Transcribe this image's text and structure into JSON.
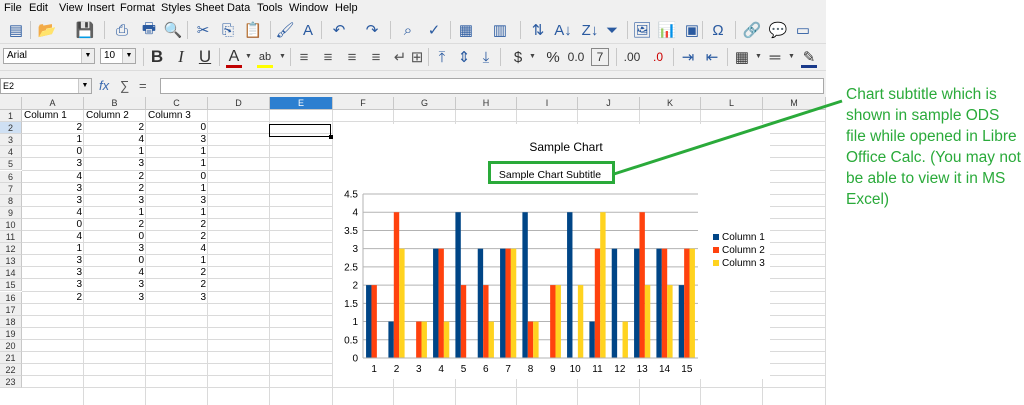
{
  "menu": [
    "File",
    "Edit",
    "View",
    "Insert",
    "Format",
    "Styles",
    "Sheet",
    "Data",
    "Tools",
    "Window",
    "Help"
  ],
  "toolbar1": {
    "icons": [
      "new-icon",
      "open-icon",
      "save-icon",
      "export-pdf-icon",
      "print-icon",
      "print-preview-icon",
      "cut-icon",
      "copy-icon",
      "paste-icon",
      "clone-formatting-icon",
      "clear-formatting-icon",
      "undo-icon",
      "redo-icon",
      "find-replace-icon",
      "spelling-icon",
      "row-icon",
      "column-icon",
      "sort-icon",
      "sort-ascending-icon",
      "sort-descending-icon",
      "autofilter-icon",
      "image-icon",
      "chart-icon",
      "pivot-table-icon",
      "special-character-icon",
      "hyperlink-icon",
      "comment-icon",
      "headers-footers-icon"
    ],
    "glyphs": [
      "▤",
      "📂",
      "💾",
      "⎙",
      "🖶",
      "🔍",
      "✂",
      "⎘",
      "📋",
      "🖌",
      "A",
      "↶",
      "↷",
      "⌕",
      "✓",
      "▦",
      "▥",
      "⇅",
      "A↓",
      "Z↓",
      "⏷",
      "🖼",
      "📊",
      "▣",
      "Ω",
      "🔗",
      "💬",
      "▭"
    ]
  },
  "toolbar2": {
    "font_name": "Arial",
    "font_size": "10",
    "glyphs": {
      "bold": "B",
      "italic": "I",
      "underline": "U",
      "font_color": "A",
      "highlight": "ab",
      "align_left": "≡",
      "align_center": "≡",
      "align_right": "≡",
      "justify": "≡",
      "wrap": "↵",
      "merge": "⊞",
      "align_top": "⤒",
      "align_middle": "⇕",
      "align_bottom": "⤓",
      "currency": "$",
      "percent": "%",
      "number": "0.0",
      "date": "7",
      "add_decimal": ".00",
      "delete_decimal": ".0",
      "indent_increase": "⇥",
      "indent_decrease": "⇤",
      "borders": "▦",
      "border_style": "═",
      "border_color": "✎"
    },
    "colors": {
      "font_color_bar": "#c00000",
      "highlight_bar": "#ffff00",
      "border_color_bar": "#1a3a8a"
    }
  },
  "formula_bar": {
    "name_box": "E2",
    "fx": "fx",
    "sum": "∑",
    "equals": "="
  },
  "columns": [
    "A",
    "B",
    "C",
    "D",
    "E",
    "F",
    "G",
    "H",
    "I",
    "J",
    "K",
    "L",
    "M"
  ],
  "selected_column": "E",
  "rows": [
    "1",
    "2",
    "3",
    "4",
    "5",
    "6",
    "7",
    "8",
    "9",
    "10",
    "11",
    "12",
    "13",
    "14",
    "15",
    "16",
    "17",
    "18",
    "19",
    "20",
    "21",
    "22",
    "23"
  ],
  "selected_row": "2",
  "cell_data": {
    "headers": [
      "Column 1",
      "Column 2",
      "Column 3"
    ],
    "values": [
      [
        2,
        2,
        0
      ],
      [
        1,
        4,
        3
      ],
      [
        0,
        1,
        1
      ],
      [
        3,
        3,
        1
      ],
      [
        4,
        2,
        0
      ],
      [
        3,
        2,
        1
      ],
      [
        3,
        3,
        3
      ],
      [
        4,
        1,
        1
      ],
      [
        0,
        2,
        2
      ],
      [
        4,
        0,
        2
      ],
      [
        1,
        3,
        4
      ],
      [
        3,
        0,
        1
      ],
      [
        3,
        4,
        2
      ],
      [
        3,
        3,
        2
      ],
      [
        2,
        3,
        3
      ]
    ]
  },
  "chart_data": {
    "type": "bar",
    "title": "Sample Chart",
    "subtitle": "Sample Chart Subtitle",
    "categories": [
      "1",
      "2",
      "3",
      "4",
      "5",
      "6",
      "7",
      "8",
      "9",
      "10",
      "11",
      "12",
      "13",
      "14",
      "15"
    ],
    "series": [
      {
        "name": "Column 1",
        "color": "#004586",
        "values": [
          2,
          1,
          0,
          3,
          4,
          3,
          3,
          4,
          0,
          4,
          1,
          3,
          3,
          3,
          2
        ]
      },
      {
        "name": "Column 2",
        "color": "#ff420e",
        "values": [
          2,
          4,
          1,
          3,
          2,
          2,
          3,
          1,
          2,
          0,
          3,
          0,
          4,
          3,
          3
        ]
      },
      {
        "name": "Column 3",
        "color": "#ffd320",
        "values": [
          0,
          3,
          1,
          1,
          0,
          1,
          3,
          1,
          2,
          2,
          4,
          1,
          2,
          2,
          3
        ]
      }
    ],
    "yticks": [
      "0",
      "0.5",
      "1",
      "1.5",
      "2",
      "2.5",
      "3",
      "3.5",
      "4",
      "4.5"
    ],
    "ylim": [
      0,
      4.5
    ],
    "grid": true,
    "legend": "right"
  },
  "annotation": {
    "text": "Chart subtitle which is shown in sample ODS file while opened in Libre Office Calc. (You may not be able to view it in MS Excel)",
    "color": "#2aaa3a"
  }
}
